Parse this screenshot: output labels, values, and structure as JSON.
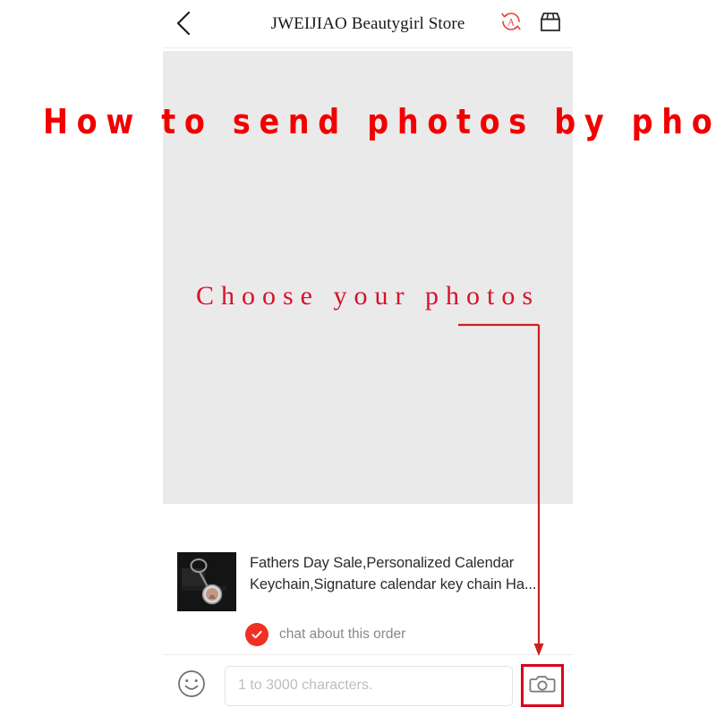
{
  "annotation": {
    "headline": "How to send photos by phone",
    "subline": "Choose your photos",
    "accent_color": "#f20000",
    "sub_color": "#d8112a",
    "arrow_color": "#cc2020",
    "highlight_box_color": "#d9001b"
  },
  "header": {
    "back_icon": "chevron-left-icon",
    "title": "JWEIJIAO Beautygirl Store",
    "actions": [
      {
        "icon": "auto-translate-icon",
        "label": "A"
      },
      {
        "icon": "store-icon",
        "label": ""
      }
    ]
  },
  "content": {
    "photo_area_placeholder": ""
  },
  "product": {
    "thumbnail_icon": "keychain-product-thumbnail",
    "title": "Fathers Day Sale,Personalized Calendar Keychain,Signature calendar key chain Ha...",
    "chat_badge_icon": "check-circle-icon",
    "chat_label": "chat about this order"
  },
  "input_bar": {
    "emoji_icon": "smiley-face-icon",
    "message_value": "",
    "message_placeholder": "1 to 3000 characters.",
    "camera_icon": "camera-icon"
  }
}
